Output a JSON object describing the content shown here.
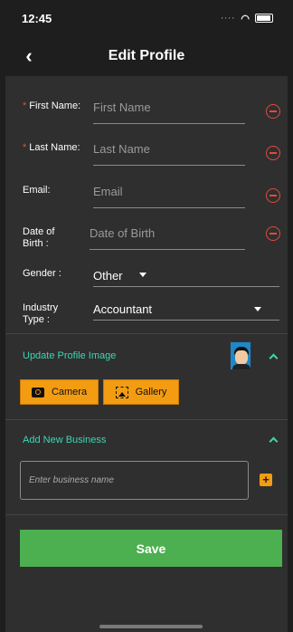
{
  "status_bar": {
    "time": "12:45",
    "signal": "····"
  },
  "nav": {
    "back_glyph": "‹",
    "title": "Edit Profile"
  },
  "fields": {
    "first_name": {
      "required_mark": "*",
      "label": "First Name:",
      "placeholder": "First Name"
    },
    "last_name": {
      "required_mark": "*",
      "label": "Last Name:",
      "placeholder": "Last Name"
    },
    "email": {
      "label": "Email:",
      "placeholder": "Email"
    },
    "dob": {
      "label_line1": "Date of",
      "label_line2": "Birth :",
      "placeholder": "Date of Birth"
    },
    "gender": {
      "label": "Gender :",
      "value": "Other"
    },
    "industry": {
      "label_line1": "Industry",
      "label_line2": "Type :",
      "value": "Accountant"
    }
  },
  "profile_image": {
    "heading": "Update Profile Image",
    "camera_label": "Camera",
    "gallery_label": "Gallery"
  },
  "business": {
    "heading": "Add New Business",
    "placeholder": "Enter business name",
    "add_glyph": "+"
  },
  "save_label": "Save",
  "colors": {
    "accent": "#3fd6b0",
    "orange": "#f39c12",
    "save_green": "#4caf50",
    "remove_red": "#e04b3a",
    "background": "#2f2f2f"
  }
}
